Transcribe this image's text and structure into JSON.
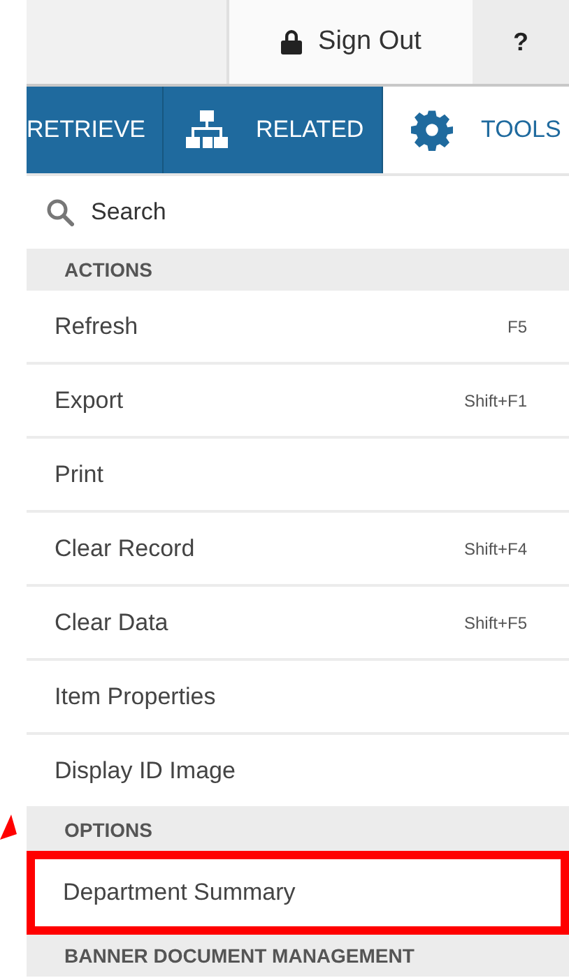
{
  "top_bar": {
    "sign_out": "Sign Out",
    "help": "?"
  },
  "tabs": [
    {
      "label": "RETRIEVE",
      "selected": false,
      "kind": "plain"
    },
    {
      "label": "RELATED",
      "selected": false,
      "kind": "hierarchy"
    },
    {
      "label": "TOOLS",
      "selected": true,
      "kind": "gear"
    }
  ],
  "search": {
    "placeholder": "Search"
  },
  "menu": [
    {
      "kind": "header",
      "label": "ACTIONS"
    },
    {
      "kind": "item",
      "label": "Refresh",
      "shortcut": "F5",
      "callout": false
    },
    {
      "kind": "item",
      "label": "Export",
      "shortcut": "Shift+F1",
      "callout": false
    },
    {
      "kind": "item",
      "label": "Print",
      "callout": false
    },
    {
      "kind": "item",
      "label": "Clear Record",
      "shortcut": "Shift+F4",
      "callout": false
    },
    {
      "kind": "item",
      "label": "Clear Data",
      "shortcut": "Shift+F5",
      "callout": false
    },
    {
      "kind": "item",
      "label": "Item Properties",
      "callout": false
    },
    {
      "kind": "item",
      "label": "Display ID Image",
      "callout": false
    },
    {
      "kind": "header",
      "label": "OPTIONS"
    },
    {
      "kind": "item",
      "label": "Department Summary",
      "callout": true
    },
    {
      "kind": "header",
      "label": "BANNER DOCUMENT MANAGEMENT"
    }
  ]
}
